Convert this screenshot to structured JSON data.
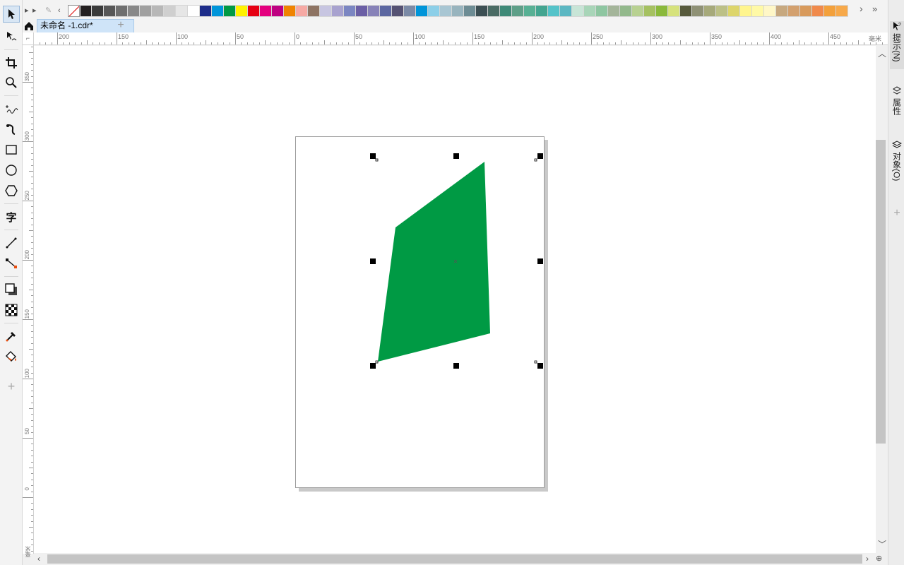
{
  "document": {
    "tab_title": "未命名 -1.cdr*",
    "add_tab_symbol": "+"
  },
  "palette": {
    "swatches": [
      "#231f20",
      "#3b3b3b",
      "#575757",
      "#6f6f6f",
      "#888888",
      "#a0a0a0",
      "#b7b7b7",
      "#cfcfcf",
      "#e6e6e6",
      "#ffffff",
      "#1d2d8a",
      "#0095da",
      "#009944",
      "#fff200",
      "#e60012",
      "#e4007f",
      "#be0081",
      "#f08300",
      "#f6a9a4",
      "#8e7463",
      "#c7c5e1",
      "#a8a2cf",
      "#7b86c2",
      "#6b5fa5",
      "#8782b8",
      "#5c67a1",
      "#555273",
      "#7b8aa6",
      "#0095d9",
      "#8ccfe8",
      "#a8c6d3",
      "#98b4be",
      "#6d8c94",
      "#3c4f53",
      "#4a6b64",
      "#3e8977",
      "#5e9f88",
      "#57b094",
      "#43a590",
      "#54c3c9",
      "#5bb7c2",
      "#c8e5d7",
      "#a8d5b8",
      "#8ec6a1",
      "#a4b59a",
      "#93b98c",
      "#b8d191",
      "#a5c160",
      "#8ab93b",
      "#d6e27c",
      "#575a3c",
      "#8f9175",
      "#a6a97a",
      "#bcc086",
      "#ddd56b",
      "#fff58e",
      "#fff9a6",
      "#fff7c7",
      "#c7a87f",
      "#d3a06e",
      "#d89a5c",
      "#f08a4b",
      "#f3a03b",
      "#f7a94a"
    ],
    "no_color_label": "无色"
  },
  "rulers": {
    "horizontal": [
      "200",
      "150",
      "100",
      "50",
      "0",
      "50",
      "100",
      "150",
      "200",
      "250",
      "300",
      "350",
      "400",
      "450"
    ],
    "vertical": [
      "350",
      "300",
      "250",
      "200",
      "150",
      "100",
      "50",
      "0"
    ],
    "unit": "毫米"
  },
  "docker": {
    "tabs": [
      "提示(N)",
      "属性",
      "对象(O)"
    ],
    "add_symbol": "+"
  },
  "tools": [
    "pick-tool",
    "shape-tool",
    "crop-tool",
    "zoom-tool",
    "freehand-tool",
    "artistic-media-tool",
    "rectangle-tool",
    "ellipse-tool",
    "polygon-tool",
    "text-tool",
    "parallel-dimension-tool",
    "connector-tool",
    "drop-shadow-tool",
    "transparency-tool",
    "eyedropper-tool",
    "interactive-fill-tool",
    "add-tool"
  ],
  "artwork": {
    "shape_fill": "#009a44"
  }
}
